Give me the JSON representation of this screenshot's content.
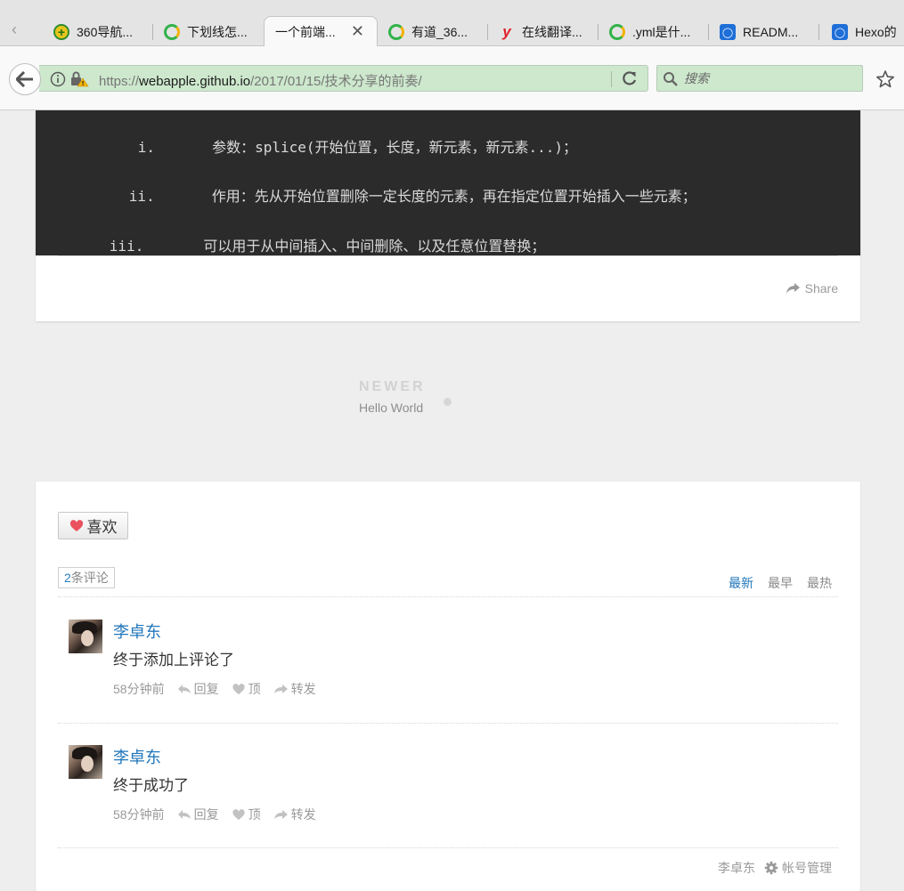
{
  "browser": {
    "tabs": [
      {
        "title": "360导航...",
        "icon": "nav360"
      },
      {
        "title": "下划线怎...",
        "icon": "ring"
      },
      {
        "title": "一个前端...",
        "icon": "none",
        "active": true
      },
      {
        "title": "有道_36...",
        "icon": "ring"
      },
      {
        "title": "在线翻译...",
        "icon": "youdao"
      },
      {
        "title": ".yml是什...",
        "icon": "ring"
      },
      {
        "title": "READM...",
        "icon": "badge"
      },
      {
        "title": "Hexo的",
        "icon": "badge"
      }
    ],
    "url": {
      "scheme": "https://",
      "host": "webapple.github.io",
      "path": "/2017/01/15/技术分享的前奏/"
    },
    "search_placeholder": "搜索"
  },
  "article": {
    "code_lines": [
      {
        "marker": "i.",
        "text": "参数：splice(开始位置，长度，新元素，新元素...)；"
      },
      {
        "marker": "ii.",
        "text": "作用：先从开始位置删除一定长度的元素，再在指定位置开始插入一些元素；"
      },
      {
        "marker": "iii.",
        "text": "可以用于从中间插入、中间删除、以及任意位置替换；"
      }
    ],
    "share_label": "Share"
  },
  "post_nav": {
    "newer_label": "NEWER",
    "newer_title": "Hello World"
  },
  "comments": {
    "like_label": "喜欢",
    "count_num": "2",
    "count_suffix": "条评论",
    "sort_tabs": [
      "最新",
      "最早",
      "最热"
    ],
    "items": [
      {
        "author": "李卓东",
        "body": "终于添加上评论了",
        "time": "58分钟前",
        "reply": "回复",
        "upvote": "顶",
        "forward": "转发"
      },
      {
        "author": "李卓东",
        "body": "终于成功了",
        "time": "58分钟前",
        "reply": "回复",
        "upvote": "顶",
        "forward": "转发"
      }
    ],
    "footer_user": "李卓东",
    "account_manage": "帐号管理"
  }
}
